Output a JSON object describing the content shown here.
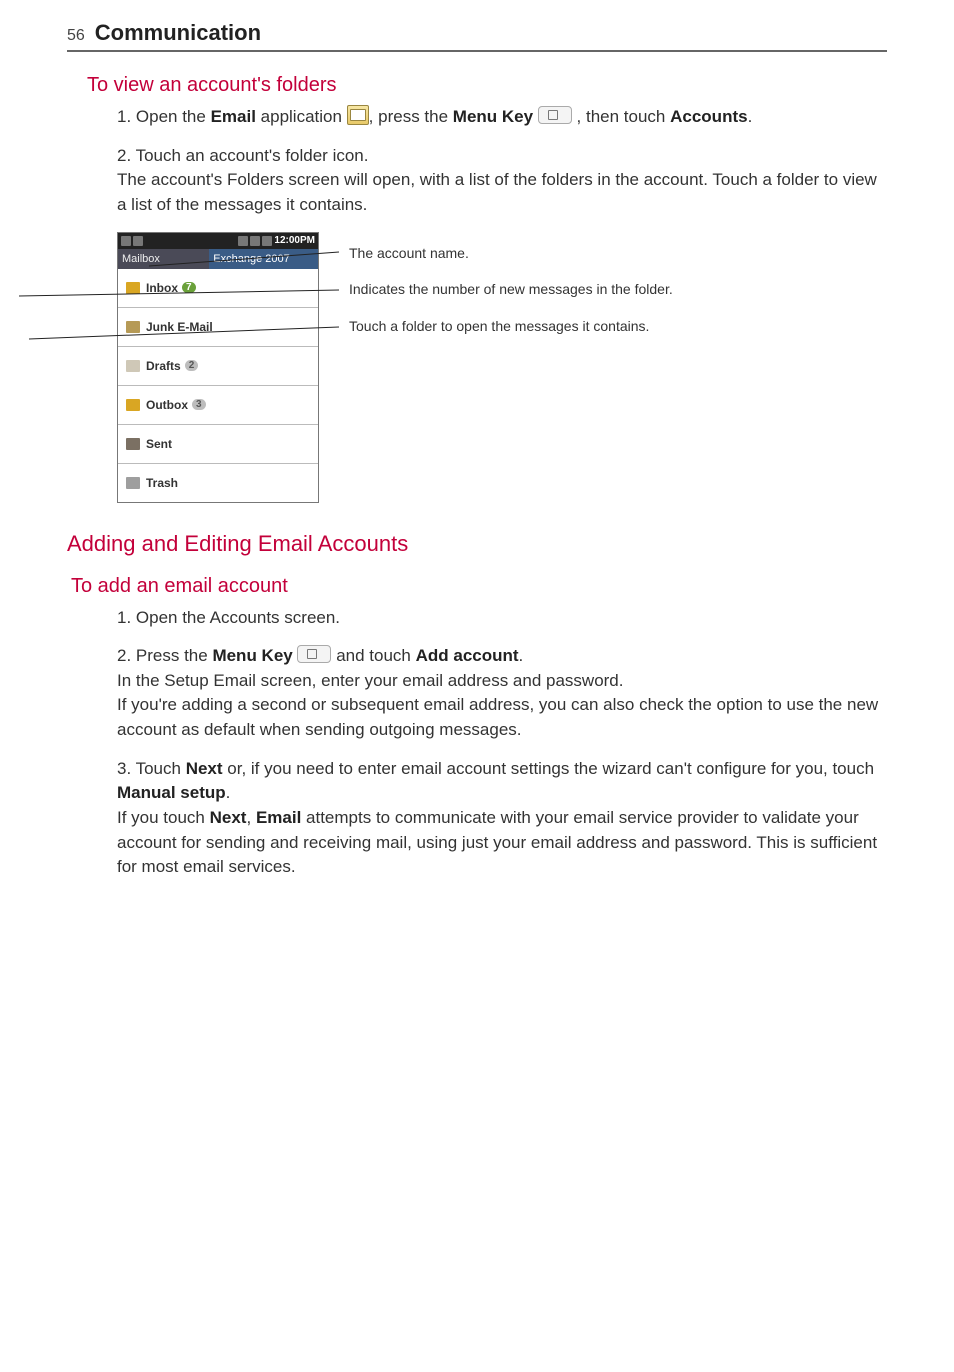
{
  "page_number": "56",
  "section_title": "Communication",
  "sub_heading_1": "To view an account's folders",
  "steps_1": {
    "s1_pre": "1. Open the ",
    "s1_email": "Email",
    "s1_mid1": " application ",
    "s1_mid2": ", press the ",
    "s1_menu": "Menu Key",
    "s1_mid3": " , then touch ",
    "s1_accounts": "Accounts",
    "s1_end": ".",
    "s2_line1": "2. Touch an account's folder icon.",
    "s2_line2": "The account's Folders screen will open, with a list of the folders in the account. Touch a folder to view a list of the messages it contains."
  },
  "phone_shot": {
    "status_time": "12:00PM",
    "mailbox_left": "Mailbox",
    "mailbox_right": "Exchange 2007",
    "folders": {
      "inbox": {
        "label": "Inbox",
        "badge": "7",
        "badge_grey": false
      },
      "junk": {
        "label": "Junk E-Mail"
      },
      "drafts": {
        "label": "Drafts",
        "badge": "2",
        "badge_grey": true
      },
      "outbox": {
        "label": "Outbox",
        "badge": "3",
        "badge_grey": true
      },
      "sent": {
        "label": "Sent"
      },
      "trash": {
        "label": "Trash"
      }
    }
  },
  "callouts": {
    "c1": "The account name.",
    "c2": "Indicates the number of new messages in the folder.",
    "c3": "Touch a folder to open the messages it contains."
  },
  "h2": "Adding and Editing Email Accounts",
  "sub_heading_2": "To add an email account",
  "steps_2": {
    "s1": "1. Open the Accounts screen.",
    "s2_pre": "2. Press the ",
    "s2_menu": "Menu Key",
    "s2_mid1": " and touch ",
    "s2_add": "Add account",
    "s2_end1": ".",
    "s2_p2": "In the Setup Email screen, enter your email address and password.",
    "s2_p3": "If you're adding a second or subsequent email address, you can also check the option to use the new account as default when sending outgoing messages.",
    "s3_pre": "3. Touch ",
    "s3_next": "Next",
    "s3_mid1": " or, if you need to enter email account settings the wizard can't configure for you, touch ",
    "s3_manual": "Manual setup",
    "s3_end1": ".",
    "s3_p2a": "If you touch ",
    "s3_p2b": "Next",
    "s3_p2c": ", ",
    "s3_p2d": "Email",
    "s3_p2e": " attempts to communicate with your email service provider to validate your account for sending and receiving mail, using just your email address and password. This is sufficient for most email services."
  }
}
